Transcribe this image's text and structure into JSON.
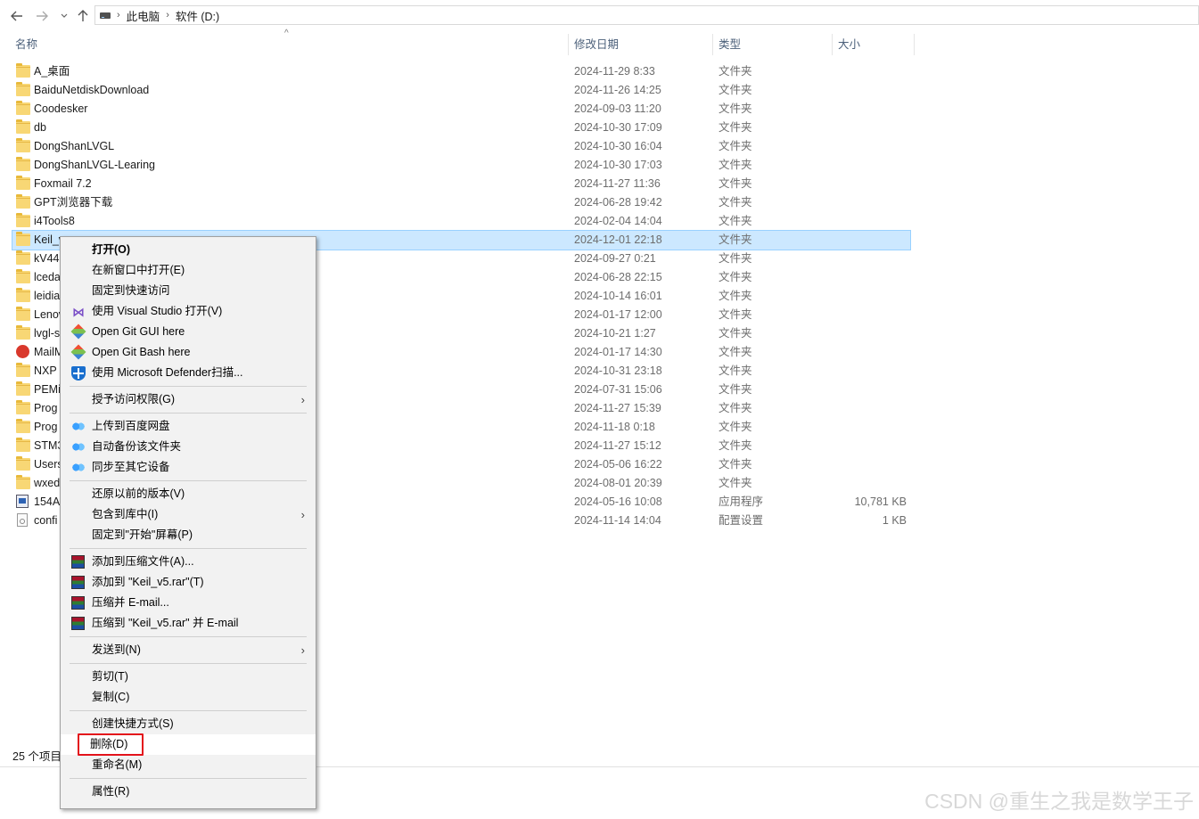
{
  "addressbar": {
    "back_icon": "back-arrow-icon",
    "forward_icon": "forward-arrow-icon",
    "recent_icon": "chevron-down-icon",
    "up_icon": "up-arrow-icon",
    "crumbs": [
      "此电脑",
      "软件 (D:)"
    ],
    "separator": "›"
  },
  "columns": {
    "name": "名称",
    "date": "修改日期",
    "type": "类型",
    "size": "大小",
    "sort_indicator": "^"
  },
  "files": [
    {
      "name": "A_桌面",
      "date": "2024-11-29 8:33",
      "type": "文件夹",
      "size": "",
      "icon": "folder"
    },
    {
      "name": "BaiduNetdiskDownload",
      "date": "2024-11-26 14:25",
      "type": "文件夹",
      "size": "",
      "icon": "folder"
    },
    {
      "name": "Coodesker",
      "date": "2024-09-03 11:20",
      "type": "文件夹",
      "size": "",
      "icon": "folder"
    },
    {
      "name": "db",
      "date": "2024-10-30 17:09",
      "type": "文件夹",
      "size": "",
      "icon": "folder"
    },
    {
      "name": "DongShanLVGL",
      "date": "2024-10-30 16:04",
      "type": "文件夹",
      "size": "",
      "icon": "folder"
    },
    {
      "name": "DongShanLVGL-Learing",
      "date": "2024-10-30 17:03",
      "type": "文件夹",
      "size": "",
      "icon": "folder"
    },
    {
      "name": "Foxmail 7.2",
      "date": "2024-11-27 11:36",
      "type": "文件夹",
      "size": "",
      "icon": "folder"
    },
    {
      "name": "GPT浏览器下载",
      "date": "2024-06-28 19:42",
      "type": "文件夹",
      "size": "",
      "icon": "folder"
    },
    {
      "name": "i4Tools8",
      "date": "2024-02-04 14:04",
      "type": "文件夹",
      "size": "",
      "icon": "folder"
    },
    {
      "name": "Keil_v",
      "date": "2024-12-01 22:18",
      "type": "文件夹",
      "size": "",
      "icon": "folder",
      "selected": true
    },
    {
      "name": "kV44",
      "date": "2024-09-27 0:21",
      "type": "文件夹",
      "size": "",
      "icon": "folder"
    },
    {
      "name": "lceda",
      "date": "2024-06-28 22:15",
      "type": "文件夹",
      "size": "",
      "icon": "folder"
    },
    {
      "name": "leidia",
      "date": "2024-10-14 16:01",
      "type": "文件夹",
      "size": "",
      "icon": "folder"
    },
    {
      "name": "Lenov",
      "date": "2024-01-17 12:00",
      "type": "文件夹",
      "size": "",
      "icon": "folder"
    },
    {
      "name": "lvgl-s",
      "date": "2024-10-21 1:27",
      "type": "文件夹",
      "size": "",
      "icon": "folder"
    },
    {
      "name": "MailM",
      "date": "2024-01-17 14:30",
      "type": "文件夹",
      "size": "",
      "icon": "mail"
    },
    {
      "name": "NXP",
      "date": "2024-10-31 23:18",
      "type": "文件夹",
      "size": "",
      "icon": "folder"
    },
    {
      "name": "PEMi",
      "date": "2024-07-31 15:06",
      "type": "文件夹",
      "size": "",
      "icon": "folder"
    },
    {
      "name": "Prog",
      "date": "2024-11-27 15:39",
      "type": "文件夹",
      "size": "",
      "icon": "folder"
    },
    {
      "name": "Prog",
      "date": "2024-11-18 0:18",
      "type": "文件夹",
      "size": "",
      "icon": "folder"
    },
    {
      "name": "STM3",
      "date": "2024-11-27 15:12",
      "type": "文件夹",
      "size": "",
      "icon": "folder"
    },
    {
      "name": "Users",
      "date": "2024-05-06 16:22",
      "type": "文件夹",
      "size": "",
      "icon": "folder"
    },
    {
      "name": "wxed",
      "date": "2024-08-01 20:39",
      "type": "文件夹",
      "size": "",
      "icon": "folder"
    },
    {
      "name": "154A",
      "date": "2024-05-16 10:08",
      "type": "应用程序",
      "size": "10,781 KB",
      "icon": "app"
    },
    {
      "name": "confi",
      "date": "2024-11-14 14:04",
      "type": "配置设置",
      "size": "1 KB",
      "icon": "config"
    }
  ],
  "status": {
    "count": "25 个项目"
  },
  "context_menu": {
    "items": [
      {
        "label": "打开(O)",
        "bold": true,
        "icon": "",
        "submenu": false
      },
      {
        "label": "在新窗口中打开(E)",
        "icon": "",
        "submenu": false
      },
      {
        "label": "固定到快速访问",
        "icon": "",
        "submenu": false
      },
      {
        "label": "使用 Visual Studio 打开(V)",
        "icon": "visual-studio",
        "submenu": false
      },
      {
        "label": "Open Git GUI here",
        "icon": "git",
        "submenu": false
      },
      {
        "label": "Open Git Bash here",
        "icon": "git",
        "submenu": false
      },
      {
        "label": "使用 Microsoft Defender扫描...",
        "icon": "defender",
        "submenu": false
      },
      {
        "sep": true
      },
      {
        "label": "授予访问权限(G)",
        "icon": "",
        "submenu": true
      },
      {
        "sep": true
      },
      {
        "label": "上传到百度网盘",
        "icon": "baidu",
        "submenu": false
      },
      {
        "label": "自动备份该文件夹",
        "icon": "baidu",
        "submenu": false
      },
      {
        "label": "同步至其它设备",
        "icon": "baidu",
        "submenu": false
      },
      {
        "sep": true
      },
      {
        "label": "还原以前的版本(V)",
        "icon": "",
        "submenu": false
      },
      {
        "label": "包含到库中(I)",
        "icon": "",
        "submenu": true
      },
      {
        "label": "固定到\"开始\"屏幕(P)",
        "icon": "",
        "submenu": false
      },
      {
        "sep": true
      },
      {
        "label": "添加到压缩文件(A)...",
        "icon": "winrar",
        "submenu": false
      },
      {
        "label": "添加到 \"Keil_v5.rar\"(T)",
        "icon": "winrar",
        "submenu": false
      },
      {
        "label": "压缩并 E-mail...",
        "icon": "winrar",
        "submenu": false
      },
      {
        "label": "压缩到 \"Keil_v5.rar\" 并 E-mail",
        "icon": "winrar",
        "submenu": false
      },
      {
        "sep": true
      },
      {
        "label": "发送到(N)",
        "icon": "",
        "submenu": true
      },
      {
        "sep": true
      },
      {
        "label": "剪切(T)",
        "icon": "",
        "submenu": false
      },
      {
        "label": "复制(C)",
        "icon": "",
        "submenu": false
      },
      {
        "sep": true
      },
      {
        "label": "创建快捷方式(S)",
        "icon": "",
        "submenu": false
      },
      {
        "label": "删除(D)",
        "icon": "",
        "submenu": false,
        "hover": true
      },
      {
        "label": "重命名(M)",
        "icon": "",
        "submenu": false
      },
      {
        "sep": true
      },
      {
        "label": "属性(R)",
        "icon": "",
        "submenu": false
      }
    ],
    "submenu_glyph": "›"
  },
  "annotation": {
    "highlight_color": "#e3131b"
  },
  "watermark": "CSDN @重生之我是数学王子",
  "colors": {
    "selected_row": "#cce8ff",
    "menu_bg": "#f2f2f2",
    "header_text": "#4c607a"
  }
}
